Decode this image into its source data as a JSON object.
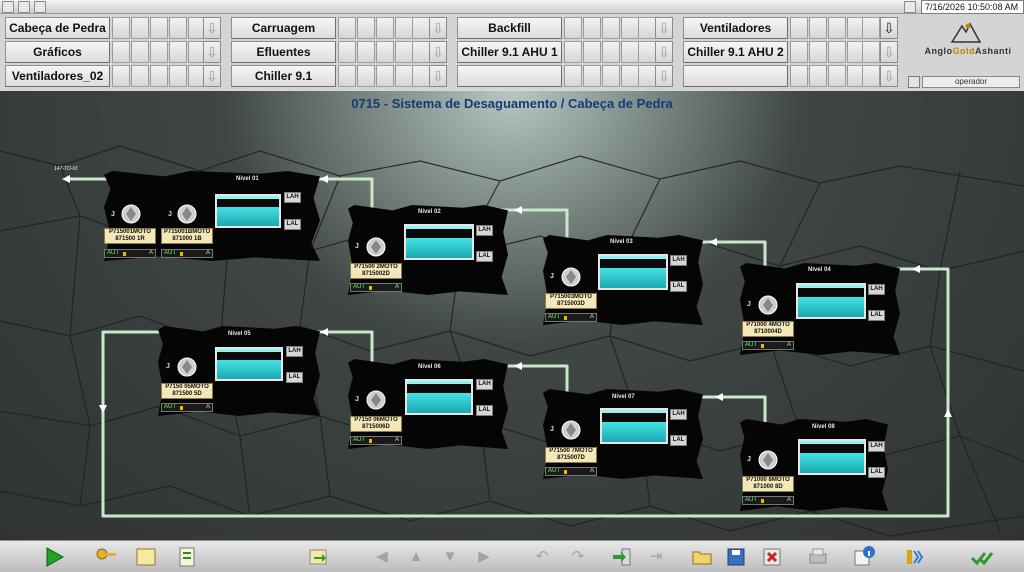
{
  "clock": "7/16/2026 10:50:08 AM",
  "nav": {
    "row1": [
      "Cabeça de Pedra",
      "Carruagem",
      "Backfill",
      "Ventiladores"
    ],
    "row2": [
      "Gráficos",
      "Efluentes",
      "Chiller 9.1 AHU 1",
      "Chiller 9.1 AHU 2"
    ],
    "row3": [
      "Ventiladores_02",
      "Chiller 9.1",
      "",
      ""
    ],
    "arrow_glyph": "⇩"
  },
  "brand": {
    "part1": "Anglo",
    "part2": "Gold",
    "part3": "Ashanti"
  },
  "user": "operador",
  "page_title": "0715 - Sistema de Desaguamento / Cabeça de Pedra",
  "corner_tag": "147-TO-01",
  "lah_label": "LAH",
  "lal_label": "LAL",
  "pump_mark": "J",
  "status": {
    "mode": "AUT",
    "auto": "A"
  },
  "levels": [
    {
      "name": "Nivel 01",
      "pumps": [
        {
          "tag": "P715001MOTO",
          "id": "871500 1R"
        },
        {
          "tag": "P715001BMOTO",
          "id": "871000 1B"
        }
      ]
    },
    {
      "name": "Nivel 02",
      "pumps": [
        {
          "tag": "P71500 2MOTO",
          "id": "8715002D"
        }
      ]
    },
    {
      "name": "Nivel 03",
      "pumps": [
        {
          "tag": "P715003MOTO",
          "id": "8715003D"
        }
      ]
    },
    {
      "name": "Nivel 04",
      "pumps": [
        {
          "tag": "P71000 4MOTO",
          "id": "8710004D"
        }
      ]
    },
    {
      "name": "Nivel 05",
      "pumps": [
        {
          "tag": "P7150 05MOTO",
          "id": "871500 5D"
        }
      ]
    },
    {
      "name": "Nivel 06",
      "pumps": [
        {
          "tag": "P7150 06MOTO",
          "id": "8715006D"
        }
      ]
    },
    {
      "name": "Nivel 07",
      "pumps": [
        {
          "tag": "P71500 7MOTO",
          "id": "8715007D"
        }
      ]
    },
    {
      "name": "Nivel 08",
      "pumps": [
        {
          "tag": "P71000 8MOTO",
          "id": "871000 8D"
        }
      ]
    }
  ],
  "toolbar": {
    "icons": [
      "play-icon",
      "key-icon",
      "open-screen-icon",
      "report-icon",
      "export-icon",
      "back-icon",
      "up-icon",
      "down-icon",
      "forward-icon",
      "undo-icon",
      "redo-icon",
      "login-icon",
      "logout-icon",
      "folder-open-icon",
      "save-icon",
      "delete-icon",
      "print-icon",
      "info-icon",
      "sound-icon",
      "acknowledge-icon"
    ]
  },
  "colors": {
    "pipe": "#c9e8c9",
    "water": "#2bd1d8",
    "title": "#163a73"
  }
}
